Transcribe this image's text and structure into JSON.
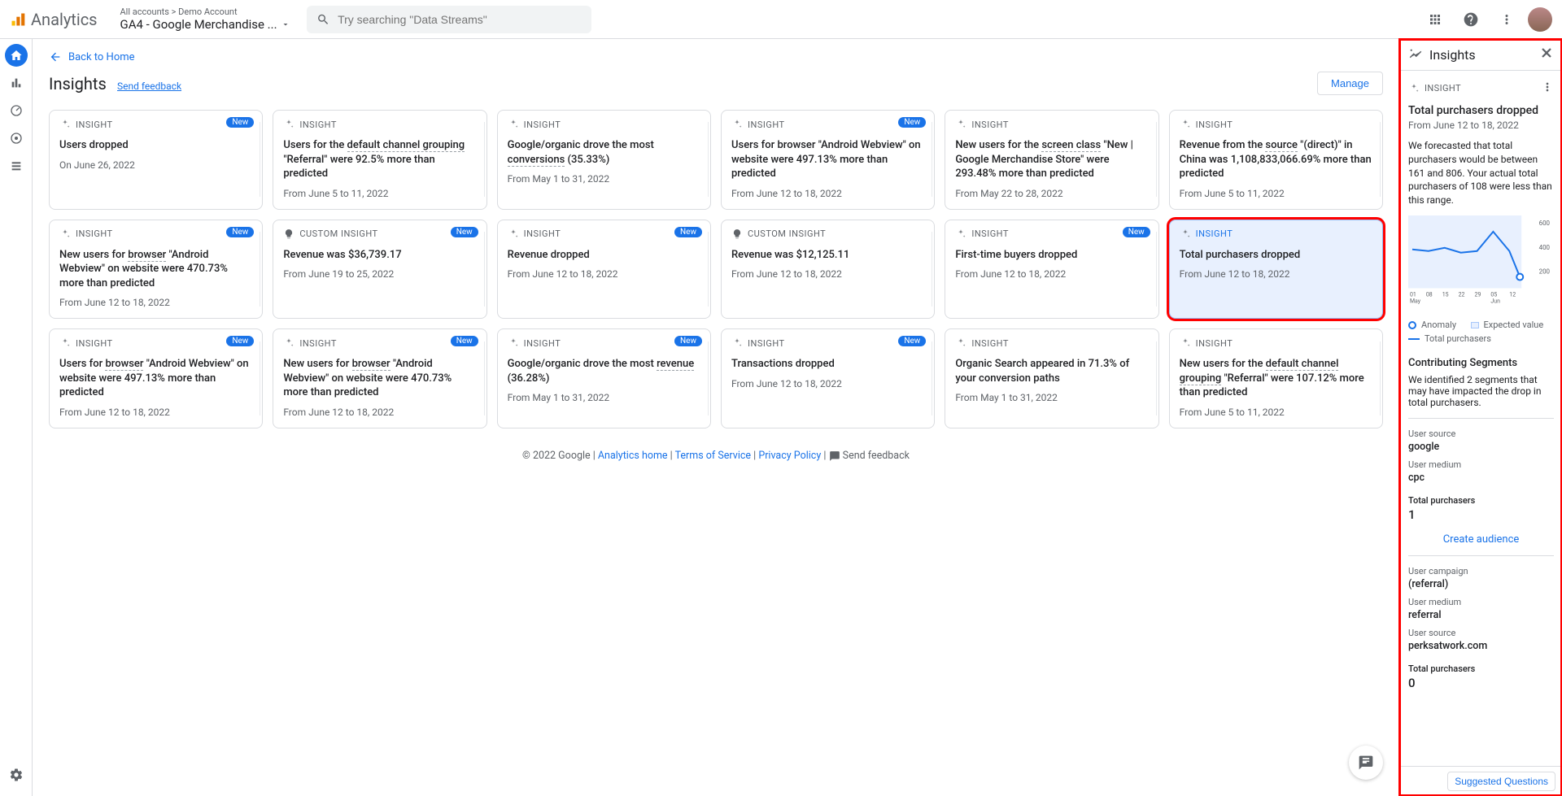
{
  "header": {
    "logo_text": "Analytics",
    "account_path": "All accounts > Demo Account",
    "property_name": "GA4 - Google Merchandise ...",
    "search_placeholder": "Try searching \"Data Streams\""
  },
  "page": {
    "back_label": "Back to Home",
    "title": "Insights",
    "send_feedback": "Send feedback",
    "manage_btn": "Manage"
  },
  "card_labels": {
    "insight": "INSIGHT",
    "custom_insight": "CUSTOM INSIGHT",
    "new_badge": "New"
  },
  "cards": [
    {
      "type": "insight",
      "badge": true,
      "title": "Users dropped",
      "date": "On June 26, 2022"
    },
    {
      "type": "insight",
      "badge": false,
      "title": "Users for the <span class='dotted'>default channel grouping</span> \"Referral\" were 92.5% more than predicted",
      "date": "From June 5 to 11, 2022"
    },
    {
      "type": "insight",
      "badge": false,
      "title": "Google/organic drove the most <span class='dotted'>conversions</span> (35.33%)",
      "date": "From May 1 to 31, 2022"
    },
    {
      "type": "insight",
      "badge": true,
      "title": "Users for browser \"Android Webview\" on website were 497.13% more than predicted",
      "date": "From June 12 to 18, 2022"
    },
    {
      "type": "insight",
      "badge": false,
      "title": "New users for the <span class='dotted'>screen class</span> \"New | Google Merchandise Store\" were 293.48% more than predicted",
      "date": "From May 22 to 28, 2022"
    },
    {
      "type": "insight",
      "badge": false,
      "title": "Revenue from the <span class='dotted'>source</span> \"(direct)\" in China was 1,108,833,066.69% more than predicted",
      "date": "From June 5 to 11, 2022"
    },
    {
      "type": "insight",
      "badge": true,
      "title": "New users for <span class='dotted'>browser</span> \"Android Webview\" on website were 470.73% more than predicted",
      "date": "From June 12 to 18, 2022"
    },
    {
      "type": "custom_insight",
      "badge": true,
      "title": "Revenue was $36,739.17",
      "date": "From June 19 to 25, 2022"
    },
    {
      "type": "insight",
      "badge": true,
      "title": "Revenue dropped",
      "date": "From June 12 to 18, 2022"
    },
    {
      "type": "custom_insight",
      "badge": false,
      "title": "Revenue was $12,125.11",
      "date": "From June 12 to 18, 2022"
    },
    {
      "type": "insight",
      "badge": true,
      "title": "First-time buyers dropped",
      "date": "From June 12 to 18, 2022"
    },
    {
      "type": "insight",
      "badge": false,
      "title": "Total purchasers dropped",
      "date": "From June 12 to 18, 2022",
      "selected": true
    },
    {
      "type": "insight",
      "badge": true,
      "title": "Users for <span class='dotted'>browser</span> \"Android Webview\" on website were 497.13% more than predicted",
      "date": "From June 12 to 18, 2022"
    },
    {
      "type": "insight",
      "badge": true,
      "title": "New users for <span class='dotted'>browser</span> \"Android Webview\" on website were 470.73% more than predicted",
      "date": "From June 12 to 18, 2022"
    },
    {
      "type": "insight",
      "badge": true,
      "title": "Google/organic drove the most <span class='dotted'>revenue</span> (36.28%)",
      "date": "From May 1 to 31, 2022"
    },
    {
      "type": "insight",
      "badge": true,
      "title": "Transactions dropped",
      "date": "From June 12 to 18, 2022"
    },
    {
      "type": "insight",
      "badge": false,
      "title": "Organic Search appeared in 71.3% of your conversion paths",
      "date": "From May 1 to 31, 2022"
    },
    {
      "type": "insight",
      "badge": false,
      "title": "New users for the <span class='dotted'>default channel grouping</span> \"Referral\" were 107.12% more than predicted",
      "date": "From June 5 to 11, 2022"
    }
  ],
  "footer": {
    "copyright": "© 2022 Google",
    "links": [
      "Analytics home",
      "Terms of Service",
      "Privacy Policy"
    ],
    "send_feedback": "Send feedback"
  },
  "panel": {
    "title": "Insights",
    "tag": "INSIGHT",
    "h1": "Total purchasers dropped",
    "sub": "From June 12 to 18, 2022",
    "desc": "We forecasted that total purchasers would be between 161 and 806. Your actual total purchasers of 108 were less than this range.",
    "legend": {
      "anomaly": "Anomaly",
      "expected": "Expected value",
      "series": "Total purchasers"
    },
    "contrib_h": "Contributing Segments",
    "contrib_d": "We identified 2 segments that may have impacted the drop in total purchasers.",
    "seg1": {
      "l1": "User source",
      "v1": "google",
      "l2": "User medium",
      "v2": "cpc",
      "l3": "Total purchasers",
      "v3": "1"
    },
    "create_audience": "Create audience",
    "seg2": {
      "l1": "User campaign",
      "v1": "(referral)",
      "l2": "User medium",
      "v2": "referral",
      "l3": "User source",
      "v3": "perksatwork.com",
      "l4": "Total purchasers",
      "v4": "0"
    },
    "suggested_btn": "Suggested Questions"
  },
  "chart_data": {
    "type": "line",
    "title": "Total purchasers",
    "xlabel": "",
    "ylabel": "",
    "ylim": [
      0,
      600
    ],
    "x_ticks": [
      "01 May",
      "08",
      "15",
      "22",
      "29",
      "05 Jun",
      "12"
    ],
    "series": [
      {
        "name": "Total purchasers",
        "values": [
          320,
          310,
          340,
          300,
          310,
          480,
          290,
          108
        ]
      }
    ],
    "anomaly_point": {
      "x": 7,
      "y": 108
    }
  }
}
